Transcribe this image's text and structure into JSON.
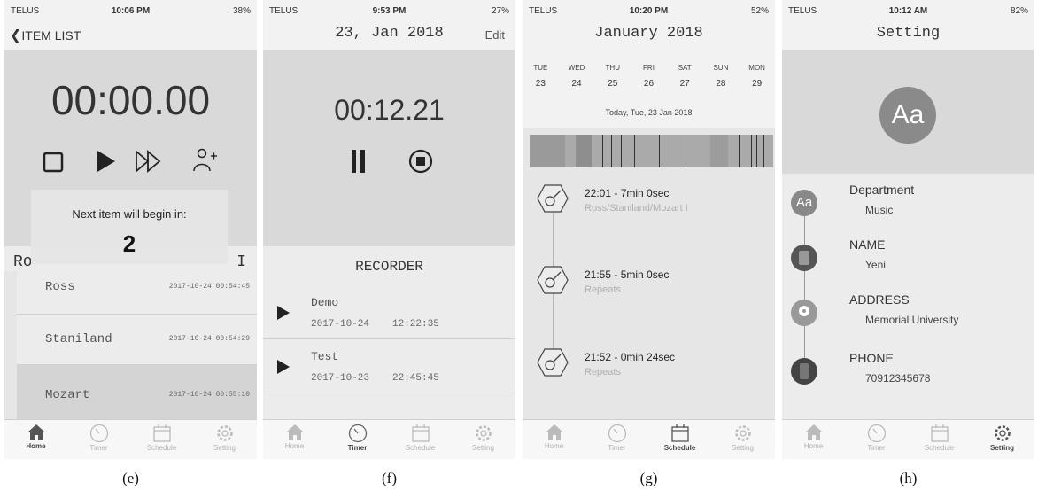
{
  "screens": [
    {
      "status": {
        "carrier": "TELUS",
        "time": "10:06 PM",
        "battery": "38%"
      },
      "nav": {
        "back_label": "ITEM LIST"
      },
      "timer": "00:00.00",
      "countdown": {
        "label": "Next item will begin in:",
        "value": "2"
      },
      "list_header": {
        "left": "Ro",
        "right": "I"
      },
      "rows": [
        {
          "name": "Ross",
          "timestamp": "2017-10-24 00:54:45"
        },
        {
          "name": "Staniland",
          "timestamp": "2017-10-24 00:54:29"
        },
        {
          "name": "Mozart",
          "timestamp": "2017-10-24 00:55:10"
        }
      ],
      "caption": "(e)"
    },
    {
      "status": {
        "carrier": "TELUS",
        "time": "9:53 PM",
        "battery": "27%"
      },
      "nav": {
        "title": "23, Jan 2018",
        "edit_label": "Edit"
      },
      "timer": "00:12.21",
      "section_title": "RECORDER",
      "recordings": [
        {
          "name": "Demo",
          "date": "2017-10-24",
          "time": "12:22:35"
        },
        {
          "name": "Test",
          "date": "2017-10-23",
          "time": "22:45:45"
        }
      ],
      "caption": "(f)"
    },
    {
      "status": {
        "carrier": "TELUS",
        "time": "10:20 PM",
        "battery": "52%"
      },
      "nav": {
        "title": "January 2018"
      },
      "week": [
        {
          "day": "TUE",
          "date": "23"
        },
        {
          "day": "WED",
          "date": "24"
        },
        {
          "day": "THU",
          "date": "25"
        },
        {
          "day": "FRI",
          "date": "26"
        },
        {
          "day": "SAT",
          "date": "27"
        },
        {
          "day": "SUN",
          "date": "28"
        },
        {
          "day": "MON",
          "date": "29"
        }
      ],
      "today_label": "Today, Tue, 23 Jan 2018",
      "events": [
        {
          "title": "22:01 - 7min 0sec",
          "subtitle": "Ross/Staniland/Mozart I"
        },
        {
          "title": "21:55 - 5min 0sec",
          "subtitle": "Repeats"
        },
        {
          "title": "21:52 - 0min 24sec",
          "subtitle": "Repeats"
        }
      ],
      "caption": "(g)"
    },
    {
      "status": {
        "carrier": "TELUS",
        "time": "10:12 AM",
        "battery": "82%"
      },
      "nav": {
        "title": "Setting"
      },
      "avatar_text": "Aa",
      "fields": [
        {
          "label": "Department",
          "value": "Music",
          "icon_text": "Aa"
        },
        {
          "label": "NAME",
          "value": "Yeni"
        },
        {
          "label": "ADDRESS",
          "value": "Memorial University"
        },
        {
          "label": "PHONE",
          "value": "70912345678"
        }
      ],
      "caption": "(h)"
    }
  ],
  "tabs": [
    {
      "label": "Home",
      "icon": "home-icon"
    },
    {
      "label": "Timer",
      "icon": "timer-icon"
    },
    {
      "label": "Schedule",
      "icon": "calendar-icon"
    },
    {
      "label": "Setting",
      "icon": "gear-icon"
    }
  ]
}
